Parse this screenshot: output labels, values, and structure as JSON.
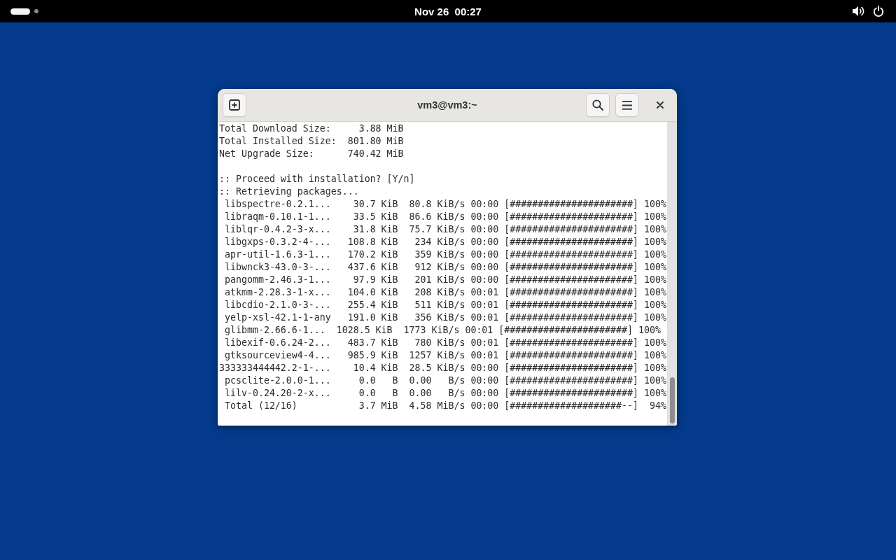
{
  "top_bar": {
    "workspaces": [
      {
        "selected": true
      },
      {
        "selected": false
      }
    ],
    "clock": "Nov 26  00:27"
  },
  "terminal": {
    "title": "vm3@vm3:~",
    "blocks": [
      {
        "lines": [
          "Total Download Size:     3.88 MiB",
          "Total Installed Size:  801.80 MiB",
          "Net Upgrade Size:      740.42 MiB"
        ]
      },
      {
        "lines": [
          ":: Proceed with installation? [Y/n]",
          ":: Retrieving packages...",
          " libspectre-0.2.1...    30.7 KiB  80.8 KiB/s 00:00 [######################] 100%",
          " libraqm-0.10.1-1...    33.5 KiB  86.6 KiB/s 00:00 [######################] 100%",
          " liblqr-0.4.2-3-x...    31.8 KiB  75.7 KiB/s 00:00 [######################] 100%",
          " libgxps-0.3.2-4-...   108.8 KiB   234 KiB/s 00:00 [######################] 100%",
          " apr-util-1.6.3-1...   170.2 KiB   359 KiB/s 00:00 [######################] 100%",
          " libwnck3-43.0-3-...   437.6 KiB   912 KiB/s 00:00 [######################] 100%",
          " pangomm-2.46.3-1...    97.9 KiB   201 KiB/s 00:00 [######################] 100%",
          " atkmm-2.28.3-1-x...   104.0 KiB   208 KiB/s 00:01 [######################] 100%",
          " libcdio-2.1.0-3-...   255.4 KiB   511 KiB/s 00:01 [######################] 100%",
          " yelp-xsl-42.1-1-any   191.0 KiB   356 KiB/s 00:01 [######################] 100%",
          " glibmm-2.66.6-1...  1028.5 KiB  1773 KiB/s 00:01 [######################] 100%",
          " libexif-0.6.24-2...   483.7 KiB   780 KiB/s 00:01 [######################] 100%",
          " gtksourceview4-4...   985.9 KiB  1257 KiB/s 00:01 [######################] 100%",
          "333333444442.2-1-...    10.4 KiB  28.5 KiB/s 00:00 [######################] 100%",
          " pcsclite-2.0.0-1...     0.0   B  0.00   B/s 00:00 [######################] 100%",
          " lilv-0.24.20-2-x...     0.0   B  0.00   B/s 00:00 [######################] 100%",
          " Total (12/16)           3.7 MiB  4.58 MiB/s 00:00 [####################--]  94%"
        ]
      }
    ]
  }
}
